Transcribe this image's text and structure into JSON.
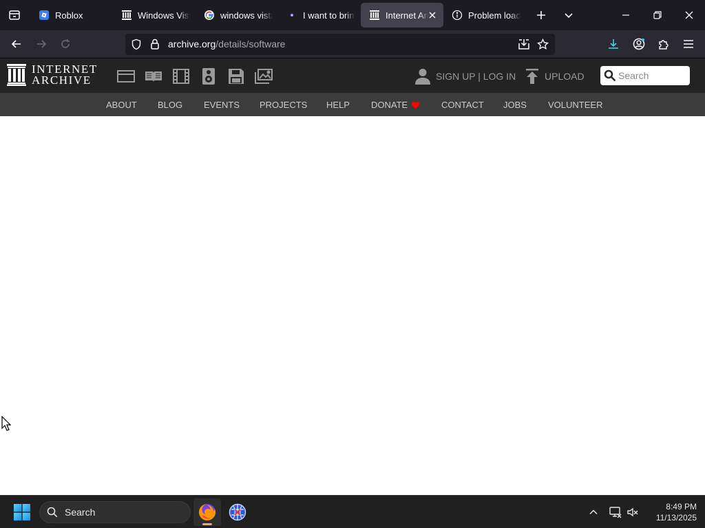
{
  "browser": {
    "tabs": [
      {
        "title": "Roblox",
        "icon": "roblox-icon",
        "active": false
      },
      {
        "title": "Windows Vista",
        "icon": "archive-icon",
        "active": false
      },
      {
        "title": "windows vista",
        "icon": "google-icon",
        "active": false
      },
      {
        "title": "I want to bring",
        "icon": "dot-icon",
        "active": false
      },
      {
        "title": "Internet Archive",
        "icon": "archive-icon",
        "active": true
      },
      {
        "title": "Problem loading",
        "icon": "info-icon",
        "active": false
      }
    ],
    "url": {
      "host": "archive.org",
      "path": "/details/software"
    }
  },
  "ia": {
    "logo_line1": "INTERNET",
    "logo_line2": "ARCHIVE",
    "media_icons": [
      "web-icon",
      "texts-icon",
      "video-icon",
      "audio-icon",
      "software-icon",
      "images-icon"
    ],
    "user_menu": "SIGN UP | LOG IN",
    "upload_label": "UPLOAD",
    "search_placeholder": "Search",
    "subnav": {
      "about": "ABOUT",
      "blog": "BLOG",
      "events": "EVENTS",
      "projects": "PROJECTS",
      "help": "HELP",
      "donate": "DONATE",
      "contact": "CONTACT",
      "jobs": "JOBS",
      "volunteer": "VOLUNTEER"
    }
  },
  "taskbar": {
    "search_label": "Search",
    "time": "8:49 PM",
    "date": "11/13/2025"
  },
  "colors": {
    "tab_strip": "#1c1b22",
    "active_tab": "#42414d",
    "ia_header": "#232323",
    "ia_subnav": "#3c3c3c",
    "donate_heart": "#ff0100"
  }
}
